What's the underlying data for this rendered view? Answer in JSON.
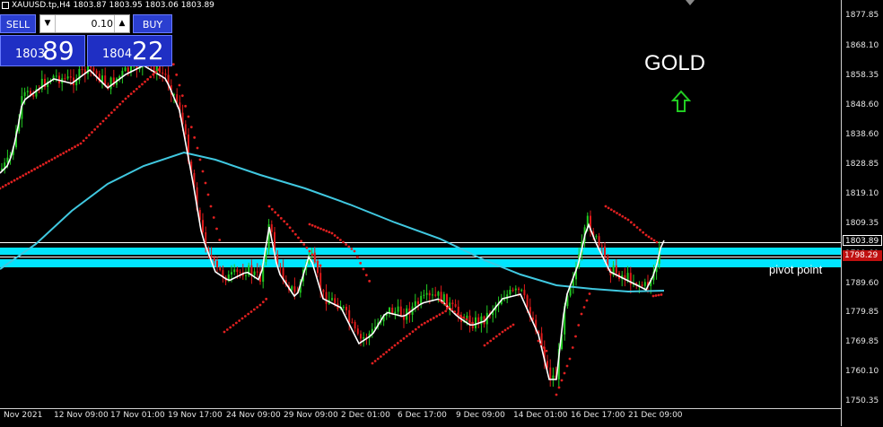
{
  "header": {
    "symbol_line": "XAUUSD.tp,H4  1803.87 1803.95 1803.06 1803.89"
  },
  "trade_panel": {
    "sell_label": "SELL",
    "buy_label": "BUY",
    "lot_value": "0.10",
    "sell_price_small": "1803",
    "sell_price_big": "89",
    "buy_price_small": "1804",
    "buy_price_big": "22"
  },
  "annotations": {
    "gold_label": "GOLD",
    "pivot_label": "pivot point"
  },
  "price_axis": {
    "labels": [
      "1877.85",
      "1868.10",
      "1858.35",
      "1848.60",
      "1838.60",
      "1828.85",
      "1819.10",
      "1809.35",
      "1799.60",
      "1789.60",
      "1779.85",
      "1769.85",
      "1760.10",
      "1750.35"
    ],
    "current_price": "1803.89",
    "pivot_price": "1798.29"
  },
  "time_axis": {
    "labels": [
      "Nov 2021",
      "12 Nov 09:00",
      "17 Nov 01:00",
      "19 Nov 17:00",
      "24 Nov 09:00",
      "29 Nov 09:00",
      "2 Dec 01:00",
      "6 Dec 17:00",
      "9 Dec 09:00",
      "14 Dec 01:00",
      "16 Dec 17:00",
      "21 Dec 09:00"
    ]
  },
  "colors": {
    "bull": "#22cc22",
    "bear": "#e01a1a",
    "fast_ma": "#ffffff",
    "slow_ma": "#40c8e0",
    "sar": "#e02020",
    "pivot_band": "#00e5ff",
    "arrow": "#22cc22"
  }
}
